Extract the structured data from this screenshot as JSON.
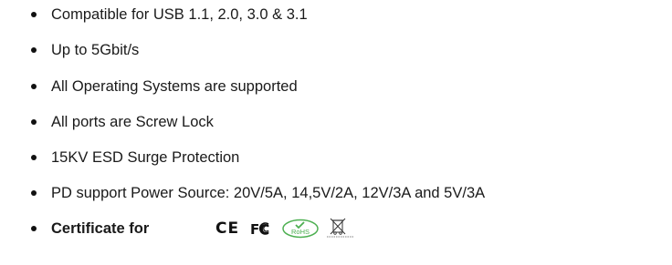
{
  "features": [
    "Compatible for USB 1.1, 2.0, 3.0 & 3.1",
    "Up to 5Gbit/s",
    "All Operating Systems are supported",
    "All ports are Screw Lock",
    "15KV ESD Surge Protection",
    "PD support Power Source: 20V/5A, 14,5V/2A, 12V/3A and 5V/3A"
  ],
  "certificate": {
    "label": "Certificate for",
    "marks": {
      "ce": "CE",
      "fc": "FC",
      "rohs": "RoHS",
      "weee_icon": "crossed-out-wheelie-bin-icon"
    }
  },
  "colors": {
    "text": "#1a1a1a",
    "rohs_green": "#4caf50"
  }
}
